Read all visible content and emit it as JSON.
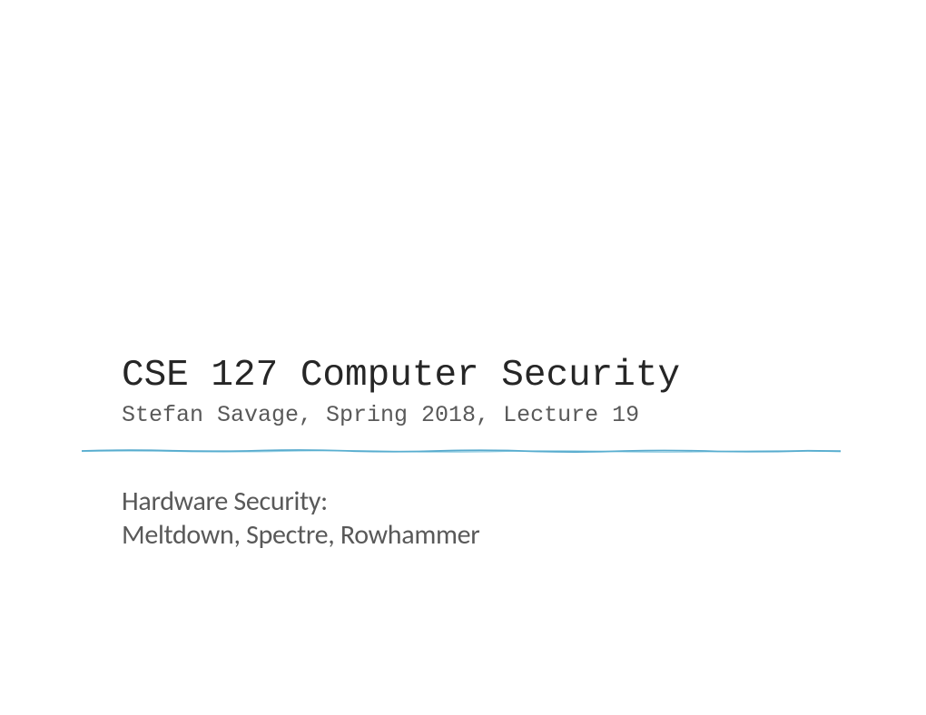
{
  "slide": {
    "title": "CSE 127 Computer Security",
    "subtitle": "Stefan Savage, Spring 2018, Lecture 19",
    "topic_line1": "Hardware Security:",
    "topic_line2": "Meltdown, Spectre, Rowhammer"
  }
}
